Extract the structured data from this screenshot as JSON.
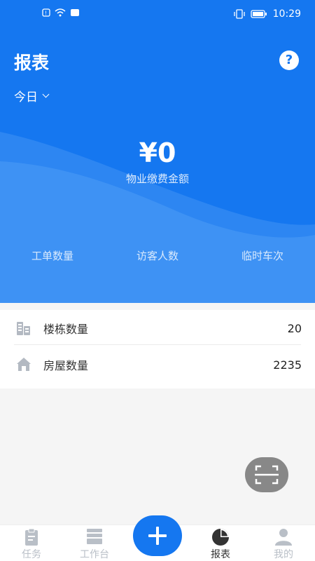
{
  "status_bar": {
    "time": "10:29"
  },
  "header": {
    "title": "报表",
    "help_label": "?"
  },
  "period": {
    "selected": "今日"
  },
  "summary": {
    "amount": "¥0",
    "amount_label": "物业缴费金额"
  },
  "stats": [
    {
      "label": "工单数量"
    },
    {
      "label": "访客人数"
    },
    {
      "label": "临时车次"
    }
  ],
  "list": [
    {
      "label": "楼栋数量",
      "value": "20",
      "icon": "building-icon"
    },
    {
      "label": "房屋数量",
      "value": "2235",
      "icon": "house-icon"
    }
  ],
  "tabs": [
    {
      "label": "任务",
      "icon": "clipboard-icon"
    },
    {
      "label": "工作台",
      "icon": "stack-icon"
    },
    {
      "label": "报表",
      "icon": "pie-chart-icon",
      "active": true
    },
    {
      "label": "我的",
      "icon": "user-icon"
    }
  ],
  "colors": {
    "primary": "#1577f0",
    "tab_inactive": "#b9bfc7"
  }
}
